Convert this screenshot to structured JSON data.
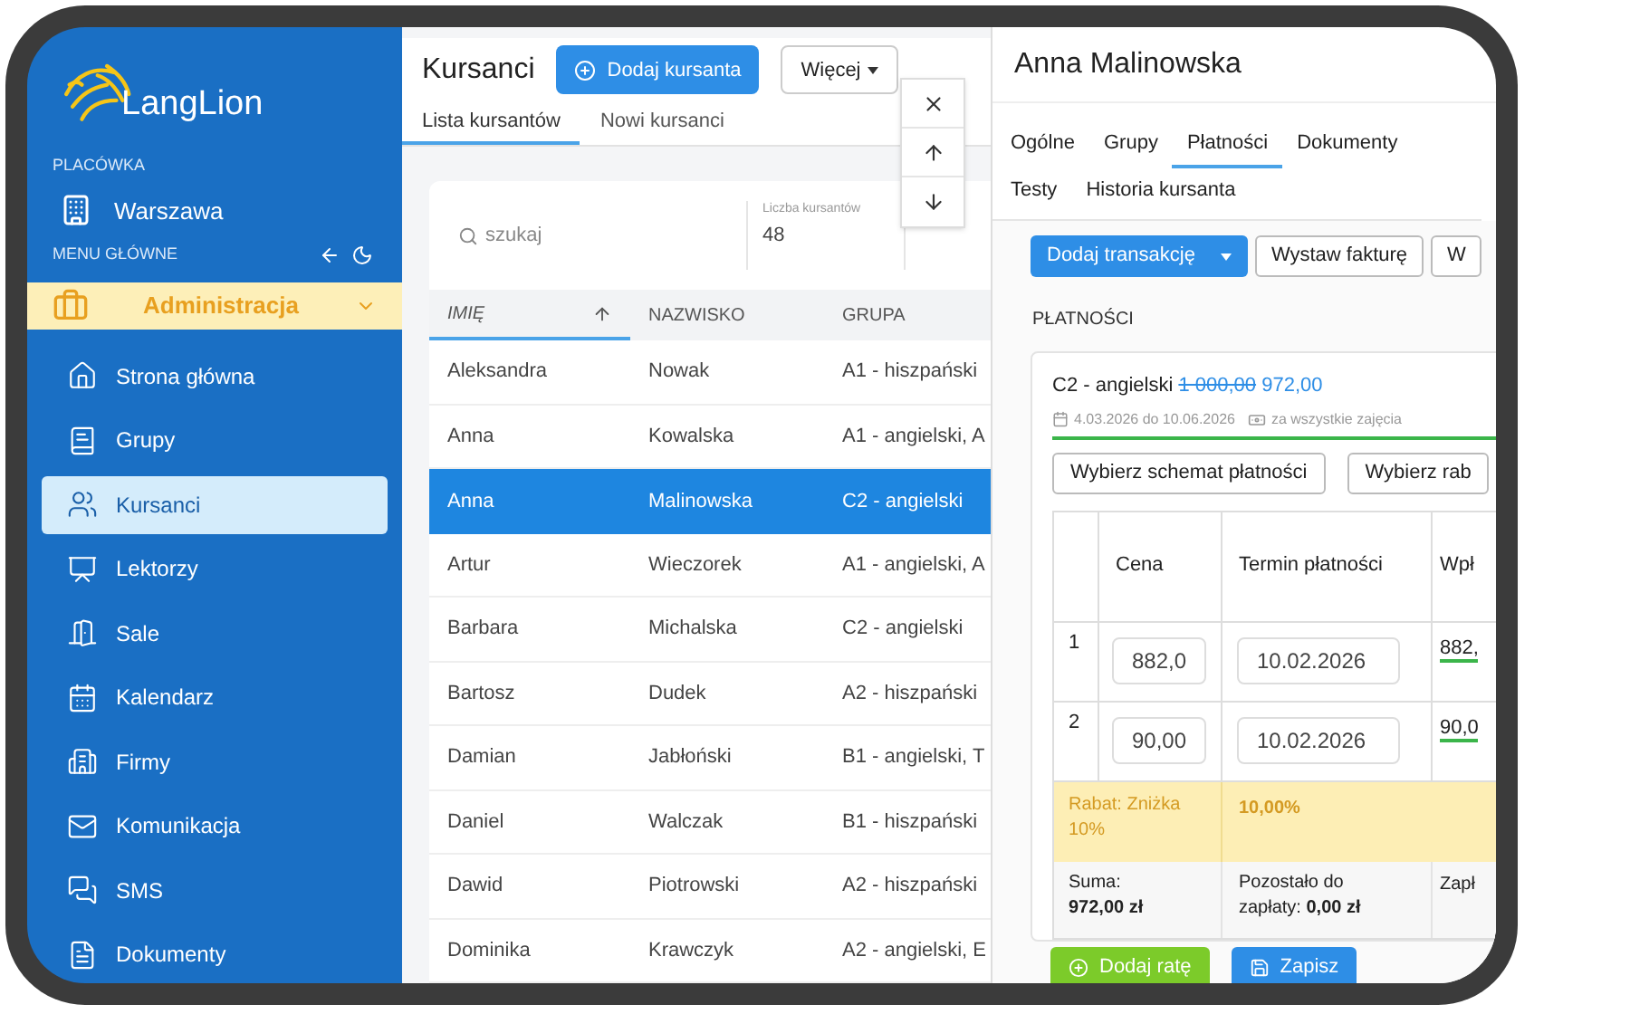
{
  "sidebar": {
    "logo": "LangLion",
    "branch_label": "PLACÓWKA",
    "branch": "Warszawa",
    "menu_label": "MENU GŁÓWNE",
    "module": {
      "label": "Administracja"
    },
    "items": [
      {
        "label": "Strona główna",
        "selected": false
      },
      {
        "label": "Grupy",
        "selected": false
      },
      {
        "label": "Kursanci",
        "selected": true
      },
      {
        "label": "Lektorzy",
        "selected": false
      },
      {
        "label": "Sale",
        "selected": false
      },
      {
        "label": "Kalendarz",
        "selected": false
      },
      {
        "label": "Firmy",
        "selected": false
      },
      {
        "label": "Komunikacja",
        "selected": false
      },
      {
        "label": "SMS",
        "selected": false
      },
      {
        "label": "Dokumenty",
        "selected": false
      }
    ]
  },
  "students": {
    "title": "Kursanci",
    "add_button": "Dodaj kursanta",
    "more_button": "Więcej",
    "tabs": [
      {
        "label": "Lista kursantów",
        "selected": true
      },
      {
        "label": "Nowi kursanci",
        "selected": false
      }
    ],
    "search": {
      "placeholder": "szukaj"
    },
    "count_label": "Liczba kursantów",
    "count": "48",
    "columns": [
      {
        "label": "IMIĘ",
        "sorted": true
      },
      {
        "label": "NAZWISKO",
        "sorted": false
      },
      {
        "label": "GRUPA",
        "sorted": false
      }
    ],
    "rows": [
      {
        "cells": [
          "Aleksandra",
          "Nowak",
          "A1 - hiszpański"
        ],
        "selected": false
      },
      {
        "cells": [
          "Anna",
          "Kowalska",
          "A1 - angielski, A"
        ],
        "selected": false
      },
      {
        "cells": [
          "Anna",
          "Malinowska",
          "C2 - angielski"
        ],
        "selected": true
      },
      {
        "cells": [
          "Artur",
          "Wieczorek",
          "A1 - angielski, A"
        ],
        "selected": false
      },
      {
        "cells": [
          "Barbara",
          "Michalska",
          "C2 - angielski"
        ],
        "selected": false
      },
      {
        "cells": [
          "Bartosz",
          "Dudek",
          "A2 - hiszpański"
        ],
        "selected": false
      },
      {
        "cells": [
          "Damian",
          "Jabłoński",
          "B1 - angielski, T"
        ],
        "selected": false
      },
      {
        "cells": [
          "Daniel",
          "Walczak",
          "B1 - hiszpański"
        ],
        "selected": false
      },
      {
        "cells": [
          "Dawid",
          "Piotrowski",
          "A2 - hiszpański"
        ],
        "selected": false
      },
      {
        "cells": [
          "Dominika",
          "Krawczyk",
          "A2 - angielski, E"
        ],
        "selected": false
      }
    ]
  },
  "detail": {
    "name": "Anna Malinowska",
    "tabs": [
      {
        "label": "Ogólne",
        "selected": false
      },
      {
        "label": "Grupy",
        "selected": false
      },
      {
        "label": "Płatności",
        "selected": true
      },
      {
        "label": "Dokumenty",
        "selected": false
      },
      {
        "label": "Testy",
        "selected": false
      },
      {
        "label": "Historia kursanta",
        "selected": false
      }
    ],
    "add_transaction": "Dodaj transakcję",
    "actions": [
      "Wystaw fakturę",
      "W"
    ],
    "section": "PŁATNOŚCI",
    "payment": {
      "group": "C2 - angielski",
      "old_price": "1 000,00",
      "price": "972,00",
      "dates": "4.03.2026 do 10.06.2026",
      "scope": "za wszystkie zajęcia",
      "buttons": [
        "Wybierz schemat płatności",
        "Wybierz rab"
      ],
      "columns": [
        "Cena",
        "Termin płatności",
        "Wpł"
      ],
      "installments": [
        {
          "number": "1",
          "price": "882,0",
          "due": "10.02.2026",
          "paid": "882,"
        },
        {
          "number": "2",
          "price": "90,00",
          "due": "10.02.2026",
          "paid": "90,0"
        }
      ],
      "discount_label": "Rabat: Zniżka 10%",
      "discount_value": "10,00%",
      "sum_label": "Suma:",
      "sum": "972,00 zł",
      "remaining_label": "Pozostało do zapłaty:",
      "remaining": "0,00 zł",
      "paid_label": "Zapł",
      "add_installment": "Dodaj ratę",
      "save": "Zapisz"
    }
  }
}
